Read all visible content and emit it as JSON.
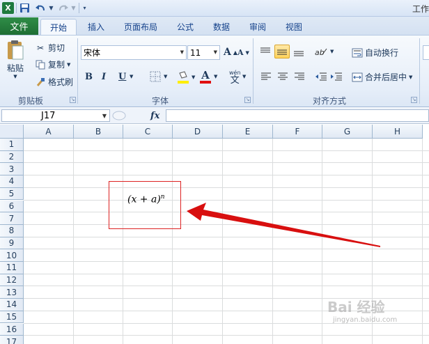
{
  "title": "工作",
  "tabs": [
    {
      "label": "文件"
    },
    {
      "label": "开始"
    },
    {
      "label": "插入"
    },
    {
      "label": "页面布局"
    },
    {
      "label": "公式"
    },
    {
      "label": "数据"
    },
    {
      "label": "审阅"
    },
    {
      "label": "视图"
    }
  ],
  "ribbon": {
    "clipboard": {
      "paste": "粘贴",
      "cut": "剪切",
      "copy": "复制",
      "format_painter": "格式刷",
      "group": "剪贴板"
    },
    "font": {
      "name": "宋体",
      "size": "11",
      "group": "字体",
      "bold": "B",
      "italic": "I",
      "underline": "U",
      "grow": "A",
      "shrink": "A",
      "font_color": "A",
      "phonetic": "wén"
    },
    "alignment": {
      "wrap": "自动换行",
      "merge": "合并后居中",
      "group": "对齐方式"
    }
  },
  "formula_bar": {
    "cell_ref": "J17",
    "fx": "fx",
    "value": ""
  },
  "columns": [
    "A",
    "B",
    "C",
    "D",
    "E",
    "F",
    "G",
    "H"
  ],
  "rows": [
    "1",
    "2",
    "3",
    "4",
    "5",
    "6",
    "7",
    "8",
    "9",
    "10",
    "11",
    "12",
    "13",
    "14",
    "15",
    "16",
    "17"
  ],
  "equation": {
    "base": "(x + a)",
    "exponent": "n"
  },
  "watermark": {
    "brand": "Bai 经验",
    "url": "jingyan.baidu.com"
  },
  "colors": {
    "file_tab": "#1e6e34",
    "highlight": "#d22",
    "accent": "#15428b"
  }
}
